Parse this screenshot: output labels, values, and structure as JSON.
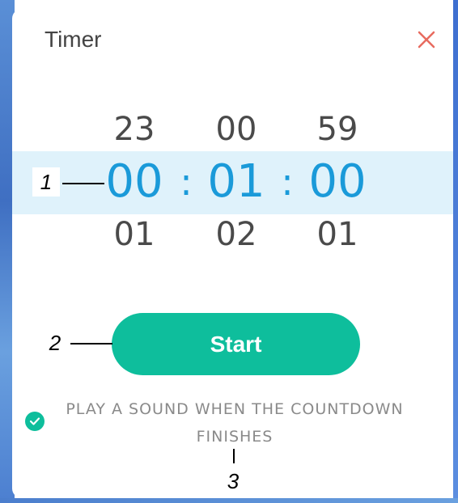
{
  "dialog": {
    "title": "Timer",
    "close_icon": "close-icon",
    "accent_color": "#0ebe9c",
    "selected_color": "#1a9ad9"
  },
  "picker": {
    "hours": {
      "above": "23",
      "selected": "00",
      "below": "01"
    },
    "minutes": {
      "above": "00",
      "selected": "01",
      "below": "02"
    },
    "seconds": {
      "above": "59",
      "selected": "00",
      "below": "01"
    },
    "separator": ":"
  },
  "start_button": {
    "label": "Start"
  },
  "sound_option": {
    "checked": true,
    "label_line1": "PLAY A SOUND WHEN THE COUNTDOWN",
    "label_line2": "FINISHES",
    "check_icon": "check-icon"
  },
  "callouts": [
    "1",
    "2",
    "3"
  ]
}
